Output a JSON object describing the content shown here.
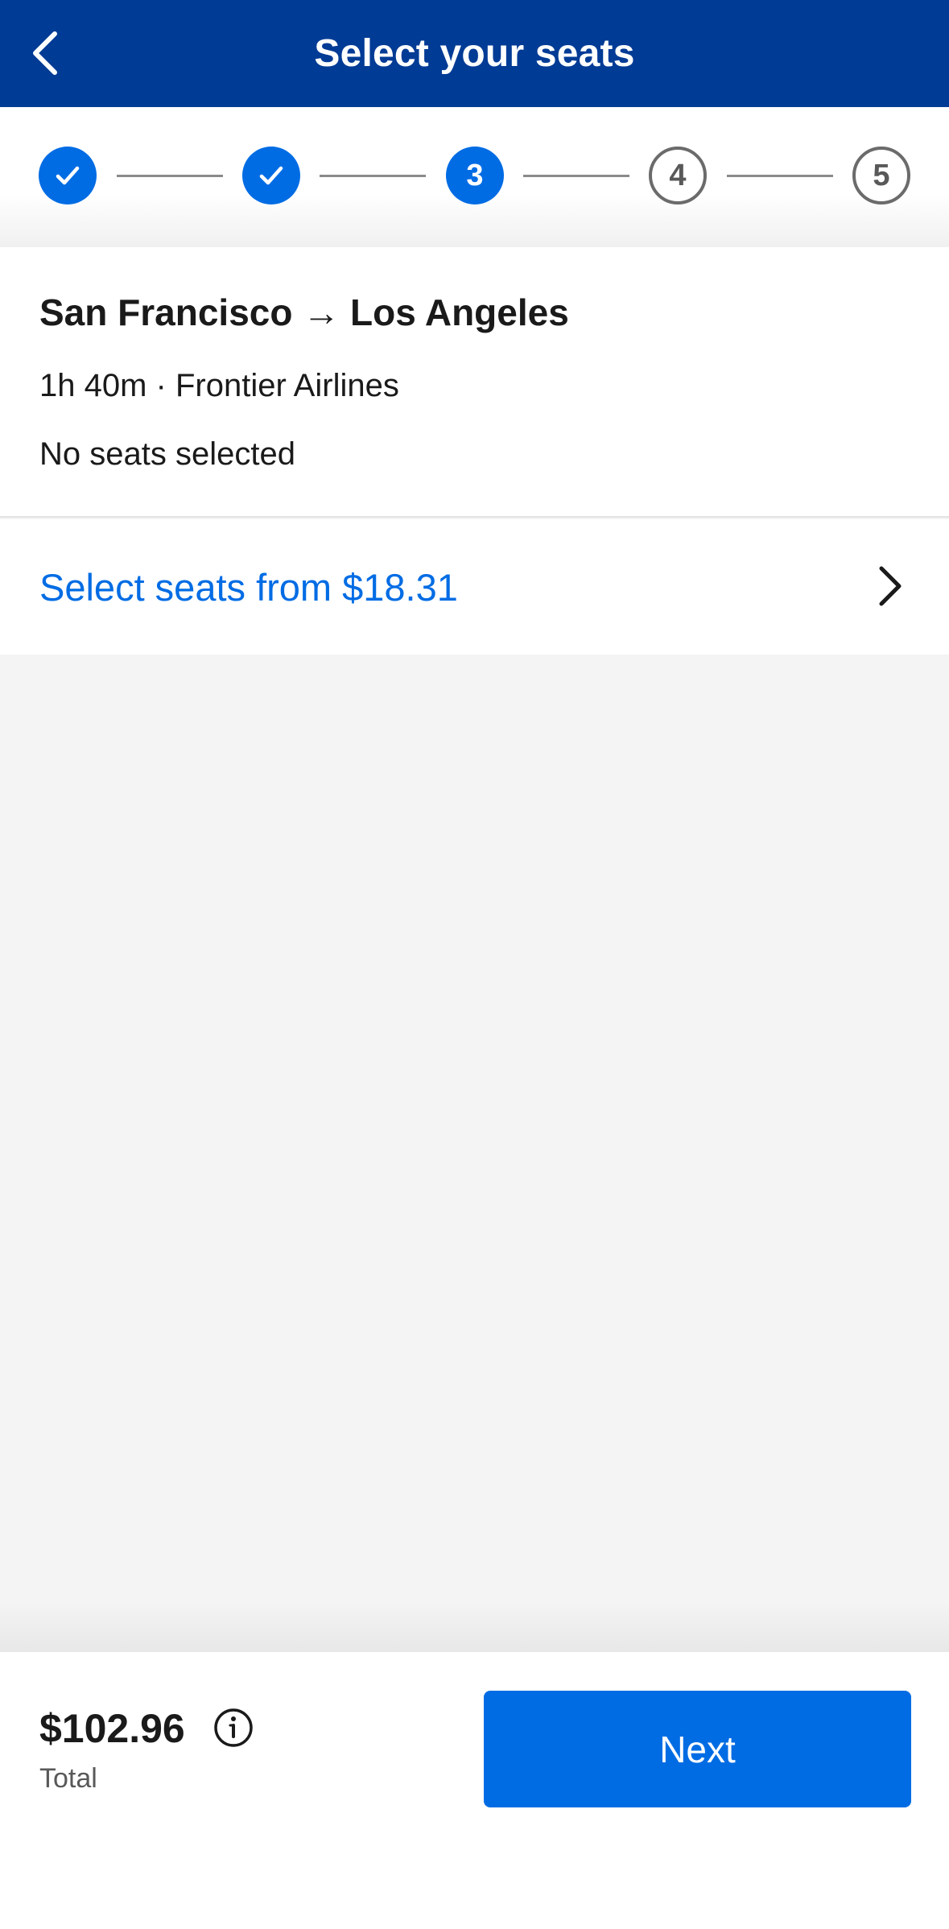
{
  "header": {
    "title": "Select your seats",
    "back_icon": "chevron-left-icon"
  },
  "stepper": {
    "current_step": 3,
    "steps": [
      {
        "label": "",
        "state": "done"
      },
      {
        "label": "",
        "state": "done"
      },
      {
        "label": "3",
        "state": "active"
      },
      {
        "label": "4",
        "state": "todo"
      },
      {
        "label": "5",
        "state": "todo"
      }
    ]
  },
  "flight": {
    "route": "San Francisco → Los Angeles",
    "meta": "1h 40m · Frontier Airlines",
    "seat_status": "No seats selected"
  },
  "seat_selection": {
    "link_label": "Select seats from $18.31",
    "icon": "chevron-right-icon"
  },
  "footer": {
    "price": "$102.96",
    "total_label": "Total",
    "info_icon": "info-icon",
    "next_label": "Next"
  },
  "colors": {
    "header_bg": "#003b95",
    "accent": "#006ce4",
    "background": "#f4f4f4"
  }
}
